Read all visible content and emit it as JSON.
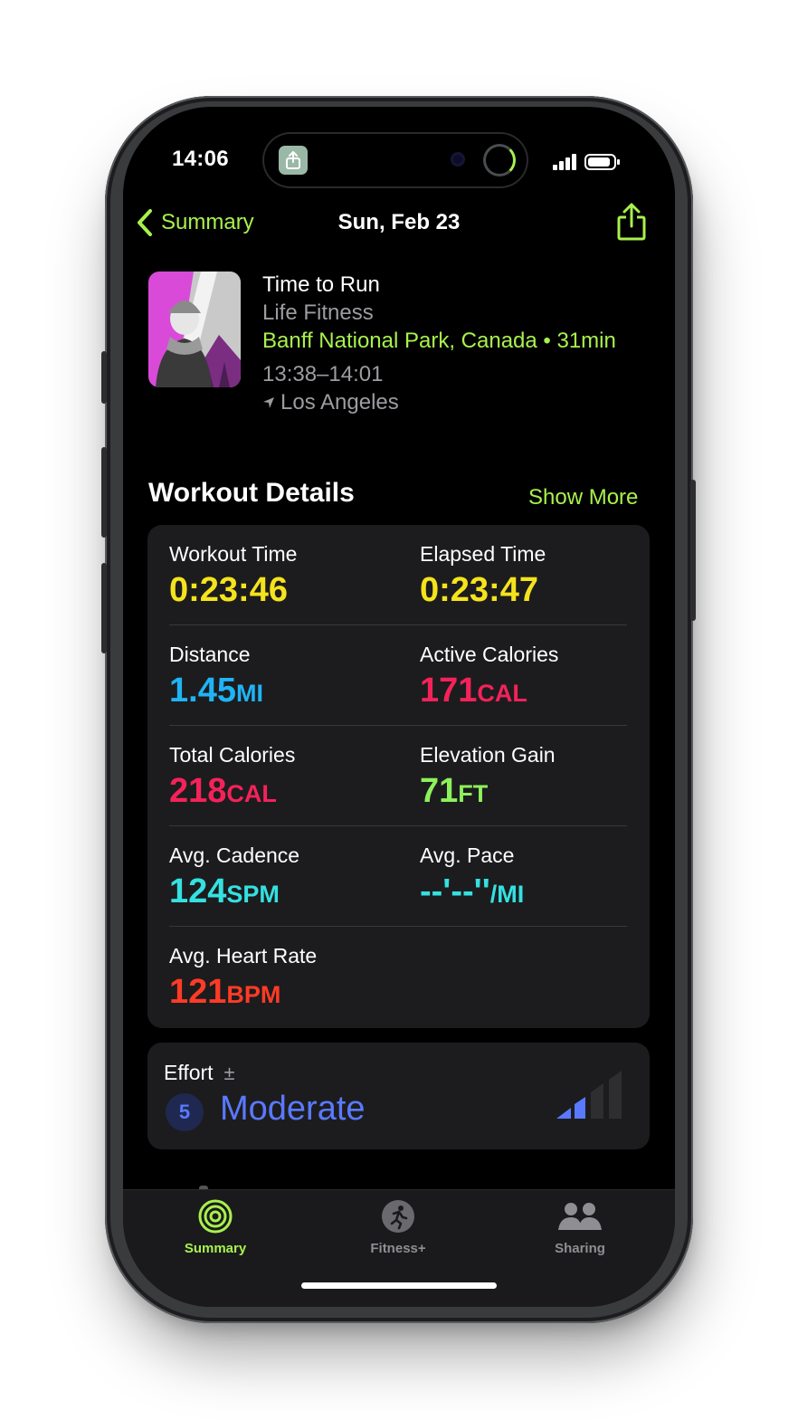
{
  "status_bar": {
    "time": "14:06"
  },
  "nav": {
    "back_label": "Summary",
    "title": "Sun, Feb 23"
  },
  "workout": {
    "title": "Time to Run",
    "subtitle": "Life Fitness",
    "episode": "Banff National Park, Canada • 31min",
    "time_range": "13:38–14:01",
    "location": "Los Angeles"
  },
  "details": {
    "heading": "Workout Details",
    "show_more": "Show More",
    "metrics": [
      {
        "label": "Workout Time",
        "value": "0:23:46",
        "unit": "",
        "color": "#f5e31c"
      },
      {
        "label": "Elapsed Time",
        "value": "0:23:47",
        "unit": "",
        "color": "#f5e31c"
      },
      {
        "label": "Distance",
        "value": "1.45",
        "unit": "MI",
        "color": "#1fb4f5"
      },
      {
        "label": "Active Calories",
        "value": "171",
        "unit": "CAL",
        "color": "#f5225a"
      },
      {
        "label": "Total Calories",
        "value": "218",
        "unit": "CAL",
        "color": "#f5225a"
      },
      {
        "label": "Elevation Gain",
        "value": "71",
        "unit": "FT",
        "color": "#8cf15b"
      },
      {
        "label": "Avg. Cadence",
        "value": "124",
        "unit": "SPM",
        "color": "#35e0e0"
      },
      {
        "label": "Avg. Pace",
        "value": "--'--''",
        "unit": "/MI",
        "color": "#35e0e0"
      },
      {
        "label": "Avg. Heart Rate",
        "value": "121",
        "unit": "BPM",
        "color": "#ff3b26"
      }
    ]
  },
  "effort": {
    "label": "Effort",
    "adjust_symbol": "±",
    "score": "5",
    "level": "Moderate"
  },
  "tabs": [
    {
      "label": "Summary",
      "icon": "activity-rings-icon",
      "active": true
    },
    {
      "label": "Fitness+",
      "icon": "runner-icon",
      "active": false
    },
    {
      "label": "Sharing",
      "icon": "people-icon",
      "active": false
    }
  ],
  "colors": {
    "accent": "#a8f14d",
    "effort": "#5a79ff",
    "card": "#1c1c1e"
  }
}
